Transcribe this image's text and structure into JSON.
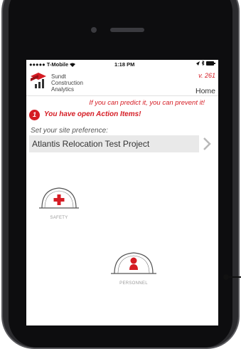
{
  "status_bar": {
    "carrier": "●●●●● T-Mobile",
    "wifi_icon": "wifi-icon",
    "time": "1:18 PM",
    "right_icons": "◂ ✱ ▬"
  },
  "header": {
    "brand_line1": "Sundt",
    "brand_line2": "Construction",
    "brand_line3": "Analytics",
    "version": "v. 261",
    "home_label": "Home"
  },
  "tagline": "If you can predict it, you can prevent it!",
  "alert": {
    "count": "1",
    "message": "You have open Action Items!"
  },
  "site_preference": {
    "label": "Set your site preference:",
    "selected": "Atlantis Relocation Test Project"
  },
  "tiles": [
    {
      "label": "SAFETY",
      "icon": "hardhat-cross-icon"
    },
    {
      "label": "PERSONNEL",
      "icon": "hardhat-person-icon"
    }
  ],
  "colors": {
    "accent_red": "#d51c24",
    "phone_body": "#2b2b2e",
    "select_bg": "#e9e9e9"
  }
}
